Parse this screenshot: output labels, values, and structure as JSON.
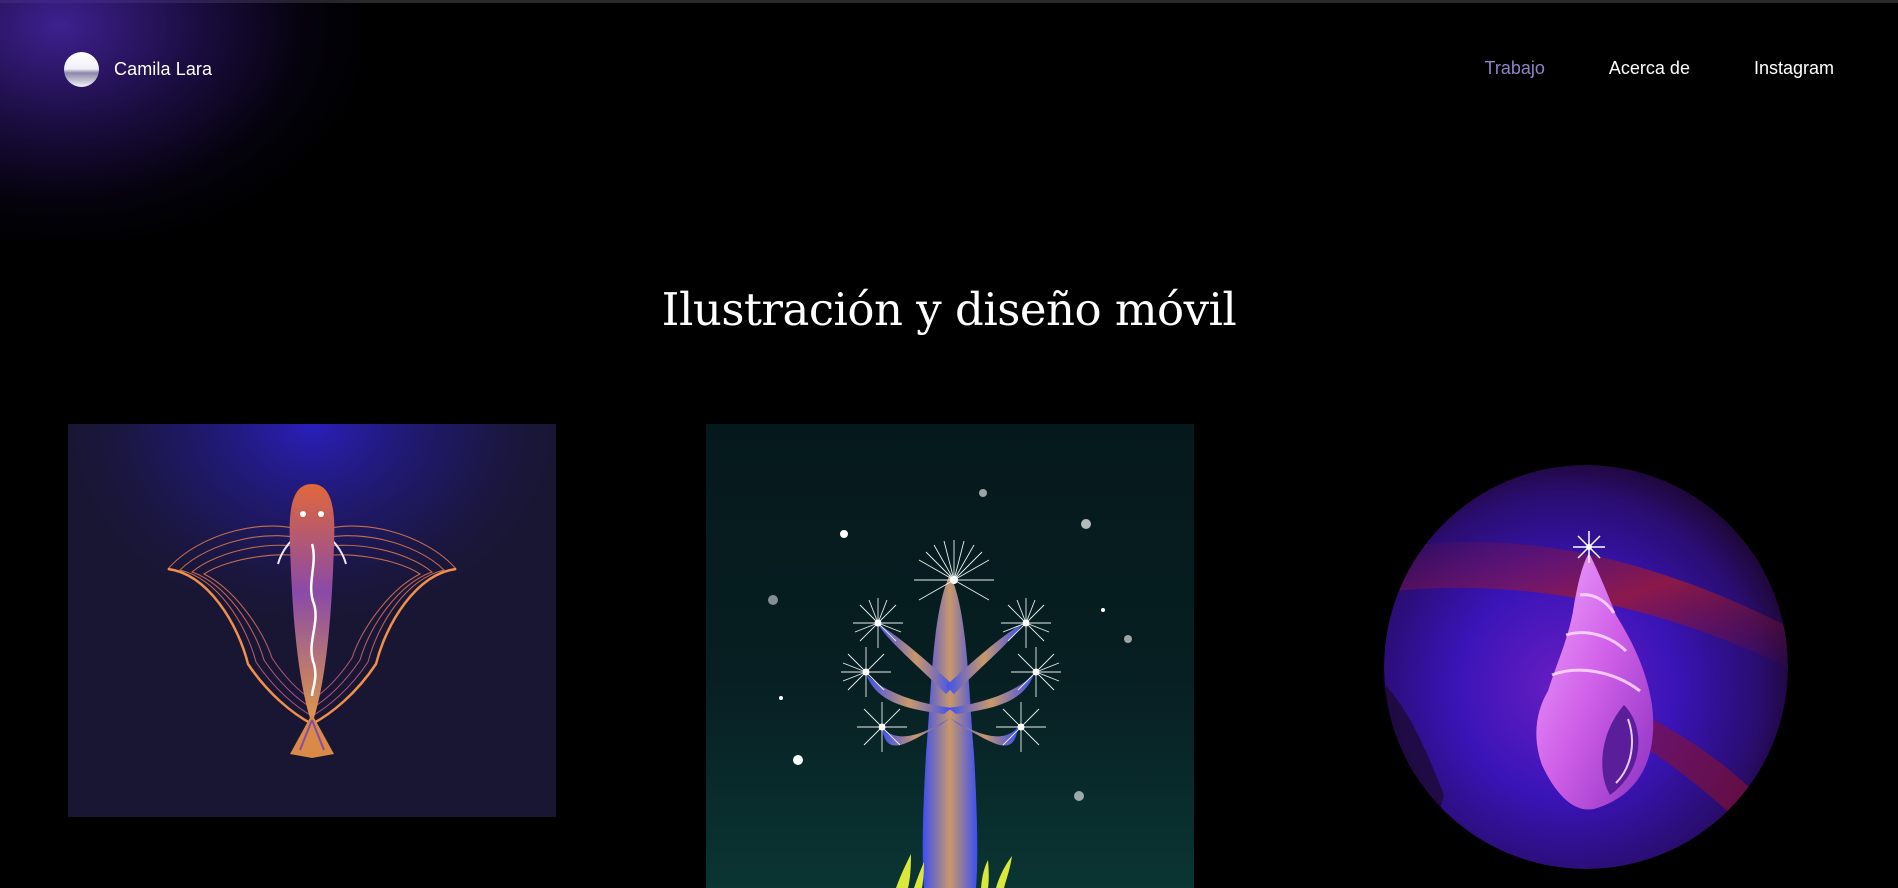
{
  "header": {
    "brand_name": "Camila Lara",
    "nav": [
      {
        "label": "Trabajo",
        "active": true
      },
      {
        "label": "Acerca de",
        "active": false
      },
      {
        "label": "Instagram",
        "active": false
      }
    ]
  },
  "main": {
    "title": "Ilustración y diseño móvil",
    "gallery": [
      {
        "subject": "flying-fish-illustration"
      },
      {
        "subject": "dandelion-tree-illustration"
      },
      {
        "subject": "seashell-illustration"
      }
    ]
  },
  "colors": {
    "background": "#000000",
    "accent_nav": "#8f84c9",
    "glow": "#4826a8",
    "text": "#ffffff"
  }
}
